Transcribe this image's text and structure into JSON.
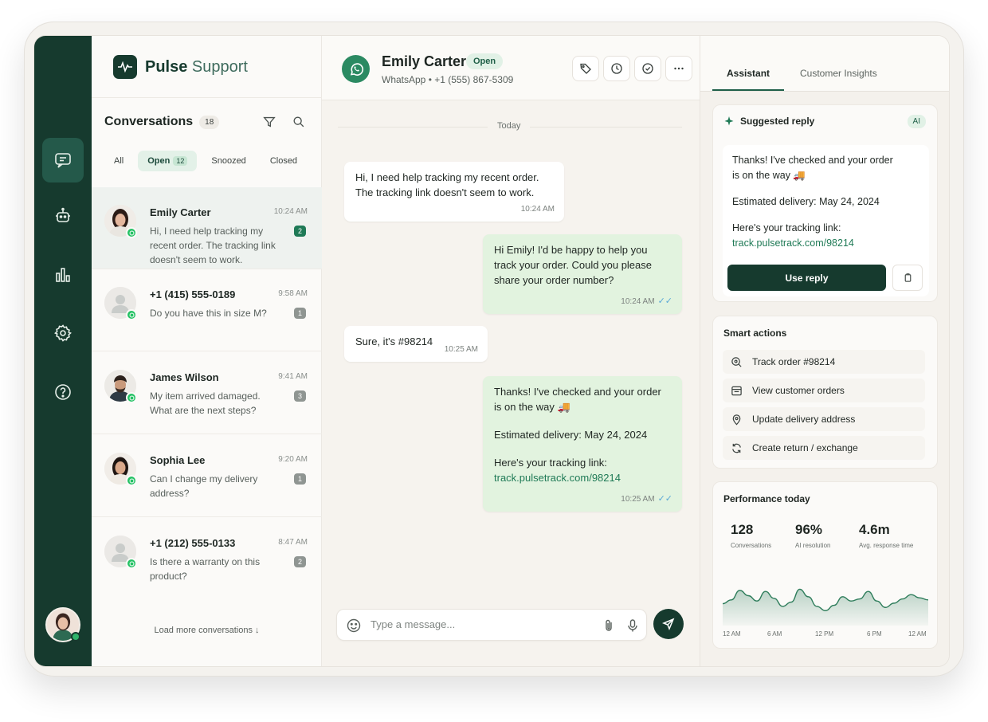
{
  "brand": {
    "name_bold": "Pulse",
    "name_light": "Support"
  },
  "conversations": {
    "title": "Conversations",
    "count": "18",
    "filters": [
      {
        "label": "All",
        "count": ""
      },
      {
        "label": "Open",
        "count": "12"
      },
      {
        "label": "Snoozed",
        "count": ""
      },
      {
        "label": "Closed",
        "count": ""
      }
    ],
    "items": [
      {
        "name": "Emily Carter",
        "time": "10:24 AM",
        "preview": "Hi, I need help tracking my recent order. The tracking link doesn't seem to work.",
        "unread": "2"
      },
      {
        "name": "+1 (415) 555-0189",
        "time": "9:58 AM",
        "preview": "Do you have this in size M?",
        "unread": "1"
      },
      {
        "name": "James Wilson",
        "time": "9:41 AM",
        "preview": "My item arrived damaged. What are the next steps?",
        "unread": "3"
      },
      {
        "name": "Sophia Lee",
        "time": "9:20 AM",
        "preview": "Can I change my delivery address?",
        "unread": "1"
      },
      {
        "name": "+1 (212) 555-0133",
        "time": "8:47 AM",
        "preview": "Is there a warranty on this product?",
        "unread": "2"
      }
    ],
    "load_more": "Load more conversations ↓"
  },
  "chat": {
    "contact_name": "Emily Carter",
    "status": "Open",
    "subtitle": "WhatsApp • +1 (555) 867-5309",
    "day_label": "Today",
    "messages": [
      {
        "dir": "in",
        "lines": [
          "Hi, I need help tracking my recent order.",
          "The tracking link doesn't seem to work."
        ],
        "time": "10:24 AM"
      },
      {
        "dir": "out",
        "lines": [
          "Hi Emily! I'd be happy to help you",
          "track your order. Could you please",
          "share your order number?"
        ],
        "time": "10:24 AM"
      },
      {
        "dir": "in",
        "lines": [
          "Sure, it's #98214"
        ],
        "time": "10:25 AM"
      },
      {
        "dir": "out",
        "line1": "Thanks! I've checked and your order",
        "line2": "is on the way 🚚",
        "line3": "Estimated delivery: May 24, 2024",
        "line4": "Here's your tracking link:",
        "link": "track.pulsetrack.com/98214",
        "time": "10:25 AM"
      }
    ],
    "composer_placeholder": "Type a message..."
  },
  "side": {
    "tabs": [
      "Assistant",
      "Customer Insights"
    ],
    "suggested": {
      "title": "Suggested reply",
      "tag": "AI",
      "line1": "Thanks! I've checked and your order",
      "line2": "is on the way 🚚",
      "line3": "Estimated delivery: May 24, 2024",
      "line4": "Here's your tracking link:",
      "link": "track.pulsetrack.com/98214",
      "use_reply": "Use reply"
    },
    "smart_actions": {
      "title": "Smart actions",
      "items": [
        "Track order #98214",
        "View customer orders",
        "Update delivery address",
        "Create return / exchange"
      ]
    },
    "performance": {
      "title": "Performance today",
      "metrics": [
        {
          "value": "128",
          "label": "Conversations"
        },
        {
          "value": "96%",
          "label": "AI resolution"
        },
        {
          "value": "4.6m",
          "label": "Avg. response time"
        }
      ],
      "x_ticks": [
        "12 AM",
        "6 AM",
        "12 PM",
        "6 PM",
        "12 AM"
      ]
    }
  },
  "chart_data": {
    "type": "area",
    "title": "",
    "xlabel": "",
    "ylabel": "",
    "categories": [
      "12 AM",
      "6 AM",
      "12 PM",
      "6 PM",
      "12 AM"
    ],
    "x": [
      0,
      1,
      2,
      3,
      4,
      5,
      6,
      7,
      8,
      9,
      10,
      11,
      12,
      13,
      14,
      15,
      16,
      17,
      18,
      19,
      20,
      21,
      22,
      23,
      24
    ],
    "values": [
      35,
      42,
      60,
      50,
      40,
      58,
      45,
      30,
      38,
      62,
      48,
      30,
      22,
      32,
      48,
      40,
      44,
      58,
      40,
      28,
      36,
      44,
      52,
      46,
      42
    ],
    "ylim": [
      0,
      100
    ],
    "grid": false,
    "color": "#2e7d5b"
  },
  "colors": {
    "primary": "#163a2e",
    "accent": "#1f7a56",
    "bubble_out": "#e2f3df"
  }
}
